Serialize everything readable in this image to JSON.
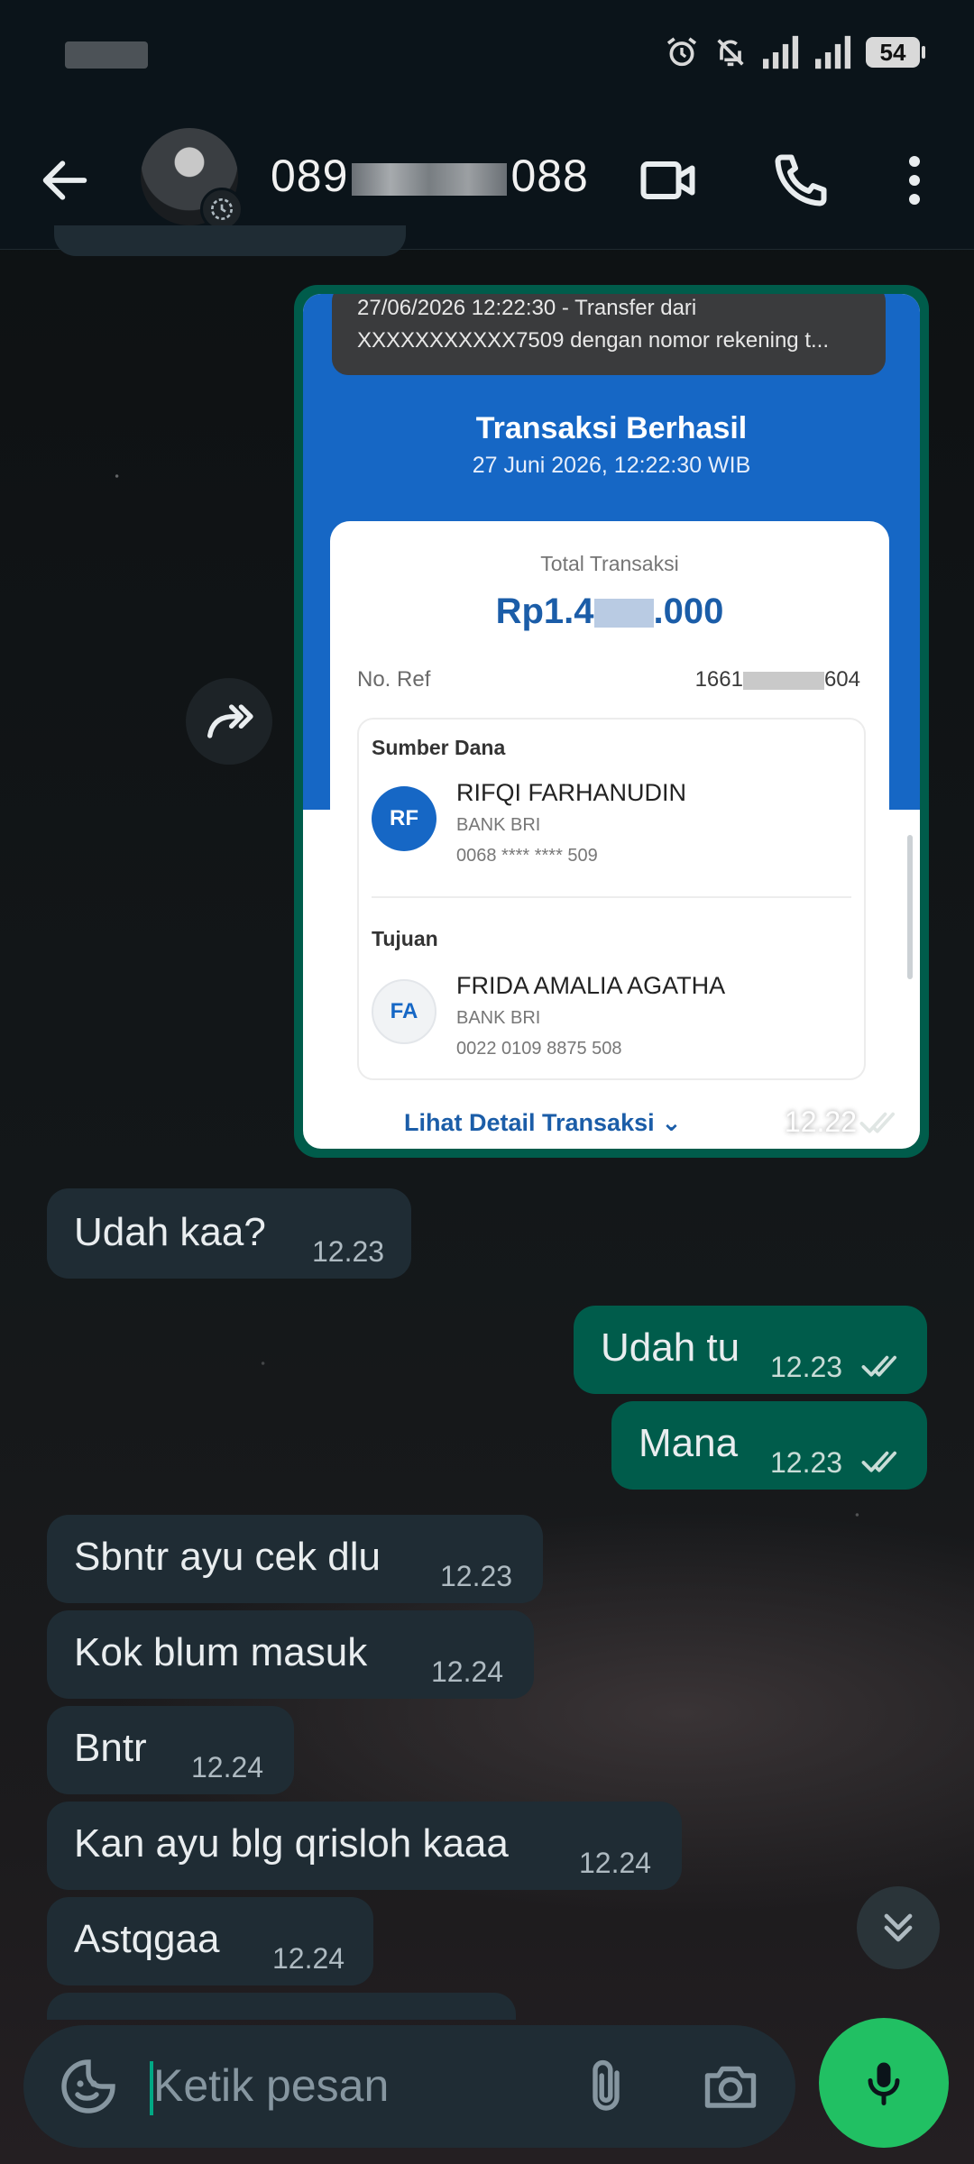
{
  "status_bar": {
    "battery": "54"
  },
  "header": {
    "contact_prefix": "089",
    "contact_suffix": "088",
    "back_icon": "back-arrow-icon",
    "video_icon": "video-call-icon",
    "call_icon": "phone-icon",
    "menu_icon": "more-vert-icon"
  },
  "image_message": {
    "notif_line1": "27/06/2026 12:22:30 -  Transfer dari",
    "notif_line2": "XXXXXXXXXXX7509 dengan nomor rekening t...",
    "title": "Transaksi Berhasil",
    "datetime": "27 Juni 2026, 12:22:30 WIB",
    "total_label": "Total Transaksi",
    "amount_prefix": "Rp1.4",
    "amount_suffix": ".000",
    "ref_label": "No. Ref",
    "ref_prefix": "1661",
    "ref_suffix": "604",
    "source_label": "Sumber Dana",
    "source_initials": "RF",
    "source_name": "RIFQI FARHANUDIN",
    "source_bank": "BANK BRI",
    "source_account": "0068 **** **** 509",
    "dest_label": "Tujuan",
    "dest_initials": "FA",
    "dest_name": "FRIDA AMALIA AGATHA",
    "dest_bank": "BANK BRI",
    "dest_account": "0022 0109 8875 508",
    "detail_link": "Lihat Detail Transaksi",
    "time": "12.22"
  },
  "messages": [
    {
      "dir": "in",
      "text": "Udah kaa?",
      "time": "12.23"
    },
    {
      "dir": "out",
      "text": "Udah tu",
      "time": "12.23"
    },
    {
      "dir": "out",
      "text": "Mana",
      "time": "12.23"
    },
    {
      "dir": "in",
      "text": "Sbntr ayu cek dlu",
      "time": "12.23"
    },
    {
      "dir": "in",
      "text": "Kok blum masuk",
      "time": "12.24"
    },
    {
      "dir": "in",
      "text": "Bntr",
      "time": "12.24"
    },
    {
      "dir": "in",
      "text": "Kan ayu blg qrisloh kaaa",
      "time": "12.24"
    },
    {
      "dir": "in",
      "text": "Astqgaa",
      "time": "12.24"
    }
  ],
  "input": {
    "placeholder": "Ketik pesan"
  },
  "colors": {
    "outgoing": "#005c4b",
    "incoming": "#1f2c34",
    "header": "#0b141a",
    "mic": "#21c063",
    "bri_blue": "#1667c5"
  }
}
